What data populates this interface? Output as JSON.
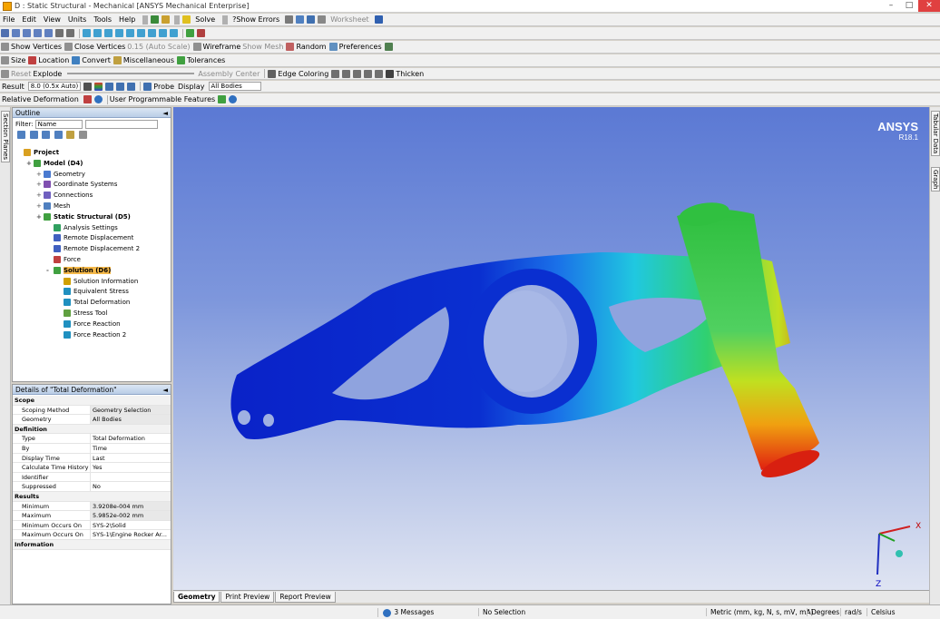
{
  "window": {
    "title": "D : Static Structural - Mechanical [ANSYS Mechanical Enterprise]"
  },
  "menu": [
    "File",
    "Edit",
    "View",
    "Units",
    "Tools",
    "Help"
  ],
  "toolbar1": {
    "solve": "Solve",
    "show_errors": "?Show Errors",
    "worksheet": "Worksheet"
  },
  "toolbar3": {
    "show_vertices": "Show Vertices",
    "close_vertices": "Close Vertices",
    "auto_scale": "0.15 (Auto Scale)",
    "wireframe": "Wireframe",
    "show_mesh": "Show Mesh",
    "random": "Random",
    "preferences": "Preferences"
  },
  "toolbar4": {
    "size": "Size",
    "location": "Location",
    "convert": "Convert",
    "miscellaneous": "Miscellaneous",
    "tolerances": "Tolerances"
  },
  "toolbar5": {
    "reset": "Reset",
    "explode": "Explode",
    "assembly_center": "Assembly Center",
    "edge_coloring": "Edge Coloring",
    "thicken": "Thicken"
  },
  "result_bar": {
    "result_label": "Result",
    "scale": "8.0 (0.5x Auto)",
    "probe": "Probe",
    "display_label": "Display",
    "display_value": "All Bodies"
  },
  "context_bar": {
    "relative_deformation": "Relative Deformation",
    "upf": "User Programmable Features"
  },
  "left_strip": {
    "tab": "Section Planes"
  },
  "right_strip": {
    "tab1": "Tabular Data",
    "tab2": "Graph"
  },
  "outline": {
    "title": "Outline",
    "filter_label": "Filter:",
    "filter_value": "Name",
    "items": [
      {
        "label": "Project",
        "level": 0,
        "bold": true,
        "color": "#d9a020"
      },
      {
        "label": "Model (D4)",
        "level": 1,
        "bold": true,
        "color": "#40a040"
      },
      {
        "label": "Geometry",
        "level": 2,
        "color": "#4a7ad0"
      },
      {
        "label": "Coordinate Systems",
        "level": 2,
        "color": "#8050b0"
      },
      {
        "label": "Connections",
        "level": 2,
        "color": "#7060c0"
      },
      {
        "label": "Mesh",
        "level": 2,
        "color": "#5080c0"
      },
      {
        "label": "Static Structural (D5)",
        "level": 2,
        "bold": true,
        "color": "#40a040"
      },
      {
        "label": "Analysis Settings",
        "level": 3,
        "color": "#30a060"
      },
      {
        "label": "Remote Displacement",
        "level": 3,
        "color": "#4060c0"
      },
      {
        "label": "Remote Displacement 2",
        "level": 3,
        "color": "#4060c0"
      },
      {
        "label": "Force",
        "level": 3,
        "color": "#c04040"
      },
      {
        "label": "Solution (D6)",
        "level": 3,
        "bold": true,
        "sel": true,
        "color": "#40a040"
      },
      {
        "label": "Solution Information",
        "level": 4,
        "color": "#d0a000"
      },
      {
        "label": "Equivalent Stress",
        "level": 4,
        "color": "#2090c0"
      },
      {
        "label": "Total Deformation",
        "level": 4,
        "color": "#2090c0"
      },
      {
        "label": "Stress Tool",
        "level": 4,
        "color": "#60a040"
      },
      {
        "label": "Force Reaction",
        "level": 4,
        "color": "#2090c0"
      },
      {
        "label": "Force Reaction 2",
        "level": 4,
        "color": "#2090c0"
      }
    ]
  },
  "details": {
    "title": "Details of \"Total Deformation\"",
    "rows": [
      {
        "k": "Scope",
        "sec": true
      },
      {
        "k": "Scoping Method",
        "v": "Geometry Selection",
        "shade": true
      },
      {
        "k": "Geometry",
        "v": "All Bodies",
        "shade": true
      },
      {
        "k": "Definition",
        "sec": true
      },
      {
        "k": "Type",
        "v": "Total Deformation"
      },
      {
        "k": "By",
        "v": "Time"
      },
      {
        "k": "Display Time",
        "v": "Last"
      },
      {
        "k": "Calculate Time History",
        "v": "Yes"
      },
      {
        "k": "Identifier",
        "v": ""
      },
      {
        "k": "Suppressed",
        "v": "No"
      },
      {
        "k": "Results",
        "sec": true
      },
      {
        "k": "Minimum",
        "v": "3.9208e-004 mm",
        "shade": true
      },
      {
        "k": "Maximum",
        "v": "5.9852e-002 mm",
        "shade": true
      },
      {
        "k": "Minimum Occurs On",
        "v": "SYS-2\\Solid"
      },
      {
        "k": "Maximum Occurs On",
        "v": "SYS-1\\Engine Rocker Ar..."
      },
      {
        "k": "Information",
        "sec": true
      }
    ]
  },
  "viewport": {
    "brand": "ANSYS",
    "version": "R18.1",
    "axis_x": "X",
    "axis_z": "Z"
  },
  "tabs": [
    "Geometry",
    "Print Preview",
    "Report Preview"
  ],
  "status": {
    "messages": "3 Messages",
    "selection": "No Selection",
    "units": "Metric (mm, kg, N, s, mV, mA)",
    "degrees": "Degrees",
    "rads": "rad/s",
    "temp": "Celsius"
  },
  "colors": {
    "accent": "#f5b94a",
    "viewport_top": "#5b79d4",
    "part_blue": "#0a2fd0",
    "part_red": "#e02010"
  }
}
